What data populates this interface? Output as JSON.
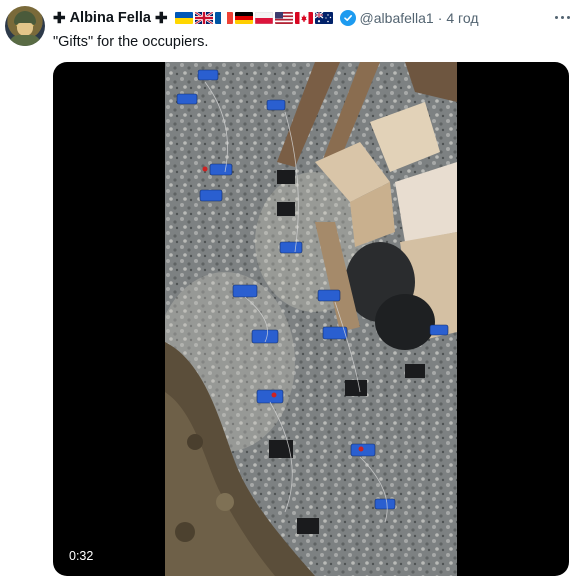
{
  "tweet": {
    "author_name": "Albina Fella",
    "cross_left": "✚",
    "cross_right": "✚",
    "handle": "@albafella1",
    "separator": "·",
    "time": "4 год",
    "text": "\"Gifts\" for the occupiers.",
    "flags": [
      "ukraine-flag",
      "uk-flag",
      "france-flag",
      "germany-flag",
      "poland-flag",
      "usa-flag",
      "canada-flag",
      "australia-flag"
    ],
    "verified_icon": "verified-badge-icon",
    "more_icon": "more-options-icon"
  },
  "media": {
    "duration": "0:32"
  },
  "colors": {
    "verified": "#1d9bf0",
    "muted_text": "#536471",
    "primary_text": "#0f1419"
  }
}
